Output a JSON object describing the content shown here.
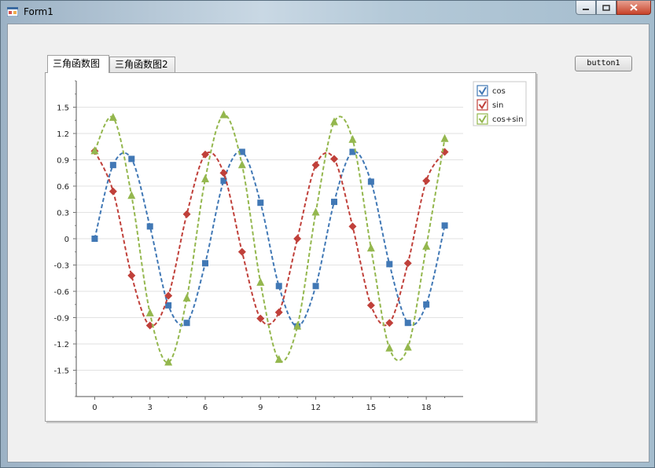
{
  "window": {
    "title": "Form1"
  },
  "tabs": [
    {
      "label": "三角函数图"
    },
    {
      "label": "三角函数图2"
    }
  ],
  "button1": {
    "label": "button1"
  },
  "colors": {
    "cos": "#4178b5",
    "sin": "#c0403a",
    "cossin": "#94b74e"
  },
  "chart_data": {
    "type": "line",
    "title": "",
    "xlabel": "",
    "ylabel": "",
    "xlim": [
      -1,
      20
    ],
    "ylim": [
      -1.8,
      1.8
    ],
    "x_ticks": [
      0,
      3,
      6,
      9,
      12,
      15,
      18
    ],
    "y_ticks": [
      1.5,
      1.2,
      0.9,
      0.6,
      0.3,
      0,
      -0.3,
      -0.6,
      -0.9,
      -1.2,
      -1.5
    ],
    "y_tick_labels": [
      "1.5",
      "1.2",
      "0.9",
      "0.6",
      "0.3",
      "0",
      "-0.3",
      "-0.6",
      "-0.9",
      "-1.2",
      "-1.5"
    ],
    "x_tick_labels": [
      "0",
      "3",
      "6",
      "9",
      "12",
      "15",
      "18"
    ],
    "grid": "horizontal",
    "legend": "top-right",
    "x": [
      0,
      1,
      2,
      3,
      4,
      5,
      6,
      7,
      8,
      9,
      10,
      11,
      12,
      13,
      14,
      15,
      16,
      17,
      18,
      19
    ],
    "series": [
      {
        "name": "cos",
        "marker": "square",
        "color": "#4178b5",
        "values": [
          0,
          0.84,
          0.91,
          0.14,
          -0.76,
          -0.96,
          -0.28,
          0.66,
          0.99,
          0.41,
          -0.54,
          -1.0,
          -0.54,
          0.42,
          0.99,
          0.65,
          -0.29,
          -0.96,
          -0.75,
          0.15
        ]
      },
      {
        "name": "sin",
        "marker": "diamond",
        "color": "#c0403a",
        "values": [
          1,
          0.54,
          -0.42,
          -0.99,
          -0.65,
          0.28,
          0.96,
          0.75,
          -0.15,
          -0.91,
          -0.84,
          0.0,
          0.84,
          0.91,
          0.14,
          -0.76,
          -0.96,
          -0.28,
          0.66,
          0.99
        ]
      },
      {
        "name": "cos+sin",
        "marker": "triangle",
        "color": "#94b74e",
        "values": [
          1,
          1.38,
          0.49,
          -0.85,
          -1.41,
          -0.68,
          0.68,
          1.41,
          0.84,
          -0.5,
          -1.38,
          -1.0,
          0.3,
          1.33,
          1.13,
          -0.11,
          -1.25,
          -1.24,
          -0.09,
          1.14
        ]
      }
    ]
  }
}
